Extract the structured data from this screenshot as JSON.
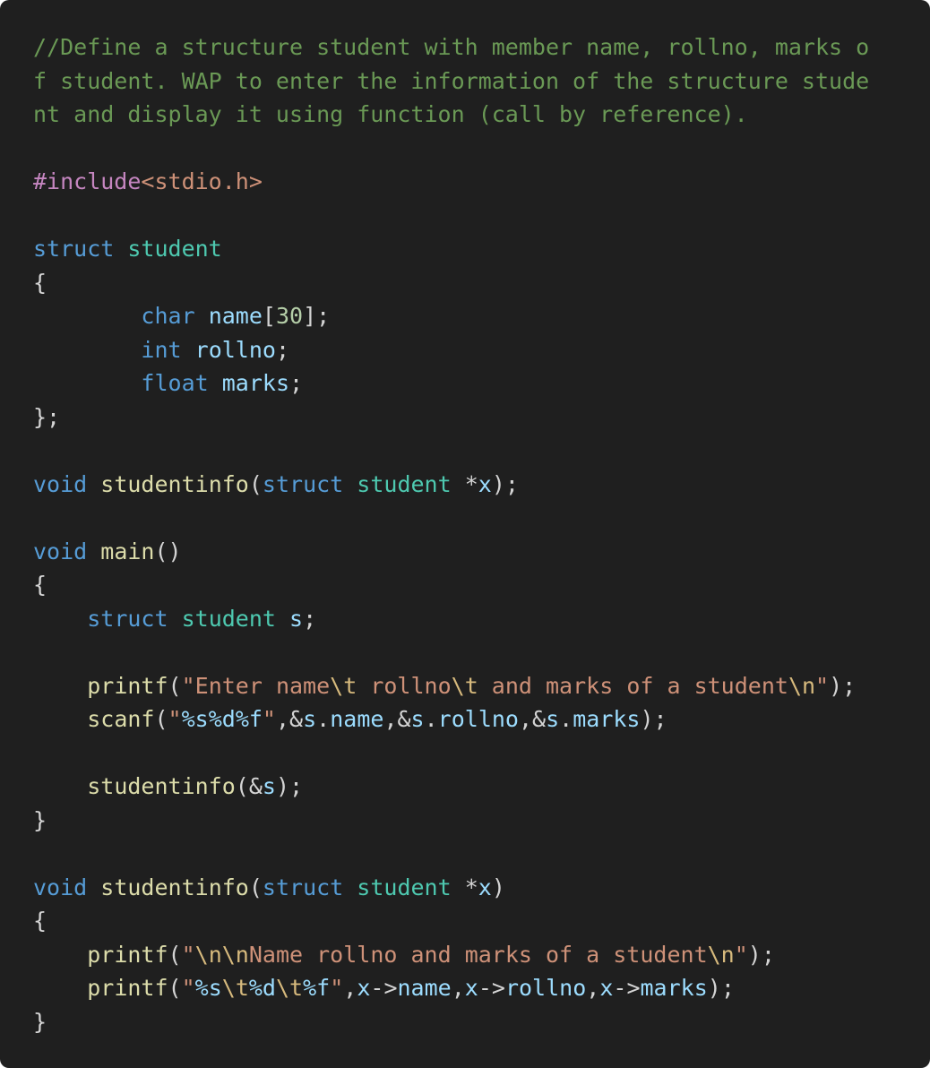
{
  "code": {
    "lines": [
      [
        {
          "t": "//Define a structure student with member name, rollno, marks o",
          "c": "comment"
        }
      ],
      [
        {
          "t": "f student. WAP to enter the information of the structure stude",
          "c": "comment"
        }
      ],
      [
        {
          "t": "nt and display it using function (call by reference).",
          "c": "comment"
        }
      ],
      [],
      [
        {
          "t": "#include",
          "c": "preproc"
        },
        {
          "t": "<stdio.h>",
          "c": "include"
        }
      ],
      [],
      [
        {
          "t": "struct",
          "c": "keyword"
        },
        {
          "t": " ",
          "c": "plain"
        },
        {
          "t": "student",
          "c": "type"
        }
      ],
      [
        {
          "t": "{",
          "c": "plain"
        }
      ],
      [
        {
          "t": "        ",
          "c": "plain"
        },
        {
          "t": "char",
          "c": "keyword"
        },
        {
          "t": " ",
          "c": "plain"
        },
        {
          "t": "name",
          "c": "var"
        },
        {
          "t": "[",
          "c": "plain"
        },
        {
          "t": "30",
          "c": "num"
        },
        {
          "t": "];",
          "c": "plain"
        }
      ],
      [
        {
          "t": "        ",
          "c": "plain"
        },
        {
          "t": "int",
          "c": "keyword"
        },
        {
          "t": " ",
          "c": "plain"
        },
        {
          "t": "rollno",
          "c": "var"
        },
        {
          "t": ";",
          "c": "plain"
        }
      ],
      [
        {
          "t": "        ",
          "c": "plain"
        },
        {
          "t": "float",
          "c": "keyword"
        },
        {
          "t": " ",
          "c": "plain"
        },
        {
          "t": "marks",
          "c": "var"
        },
        {
          "t": ";",
          "c": "plain"
        }
      ],
      [
        {
          "t": "};",
          "c": "plain"
        }
      ],
      [],
      [
        {
          "t": "void",
          "c": "keyword"
        },
        {
          "t": " ",
          "c": "plain"
        },
        {
          "t": "studentinfo",
          "c": "func"
        },
        {
          "t": "(",
          "c": "plain"
        },
        {
          "t": "struct",
          "c": "keyword"
        },
        {
          "t": " ",
          "c": "plain"
        },
        {
          "t": "student",
          "c": "type"
        },
        {
          "t": " *",
          "c": "plain"
        },
        {
          "t": "x",
          "c": "var"
        },
        {
          "t": ");",
          "c": "plain"
        }
      ],
      [],
      [
        {
          "t": "void",
          "c": "keyword"
        },
        {
          "t": " ",
          "c": "plain"
        },
        {
          "t": "main",
          "c": "func"
        },
        {
          "t": "()",
          "c": "plain"
        }
      ],
      [
        {
          "t": "{",
          "c": "plain"
        }
      ],
      [
        {
          "t": "    ",
          "c": "plain"
        },
        {
          "t": "struct",
          "c": "keyword"
        },
        {
          "t": " ",
          "c": "plain"
        },
        {
          "t": "student",
          "c": "type"
        },
        {
          "t": " ",
          "c": "plain"
        },
        {
          "t": "s",
          "c": "var"
        },
        {
          "t": ";",
          "c": "plain"
        }
      ],
      [],
      [
        {
          "t": "    ",
          "c": "plain"
        },
        {
          "t": "printf",
          "c": "func"
        },
        {
          "t": "(",
          "c": "plain"
        },
        {
          "t": "\"Enter name",
          "c": "string"
        },
        {
          "t": "\\t",
          "c": "escape"
        },
        {
          "t": " rollno",
          "c": "string"
        },
        {
          "t": "\\t",
          "c": "escape"
        },
        {
          "t": " and marks of a student",
          "c": "string"
        },
        {
          "t": "\\n",
          "c": "escape"
        },
        {
          "t": "\"",
          "c": "string"
        },
        {
          "t": ");",
          "c": "plain"
        }
      ],
      [
        {
          "t": "    ",
          "c": "plain"
        },
        {
          "t": "scanf",
          "c": "func"
        },
        {
          "t": "(",
          "c": "plain"
        },
        {
          "t": "\"",
          "c": "string"
        },
        {
          "t": "%s%d%f",
          "c": "var"
        },
        {
          "t": "\"",
          "c": "string"
        },
        {
          "t": ",&",
          "c": "plain"
        },
        {
          "t": "s",
          "c": "var"
        },
        {
          "t": ".",
          "c": "plain"
        },
        {
          "t": "name",
          "c": "var"
        },
        {
          "t": ",&",
          "c": "plain"
        },
        {
          "t": "s",
          "c": "var"
        },
        {
          "t": ".",
          "c": "plain"
        },
        {
          "t": "rollno",
          "c": "var"
        },
        {
          "t": ",&",
          "c": "plain"
        },
        {
          "t": "s",
          "c": "var"
        },
        {
          "t": ".",
          "c": "plain"
        },
        {
          "t": "marks",
          "c": "var"
        },
        {
          "t": ");",
          "c": "plain"
        }
      ],
      [],
      [
        {
          "t": "    ",
          "c": "plain"
        },
        {
          "t": "studentinfo",
          "c": "func"
        },
        {
          "t": "(&",
          "c": "plain"
        },
        {
          "t": "s",
          "c": "var"
        },
        {
          "t": ");",
          "c": "plain"
        }
      ],
      [
        {
          "t": "}",
          "c": "plain"
        }
      ],
      [],
      [
        {
          "t": "void",
          "c": "keyword"
        },
        {
          "t": " ",
          "c": "plain"
        },
        {
          "t": "studentinfo",
          "c": "func"
        },
        {
          "t": "(",
          "c": "plain"
        },
        {
          "t": "struct",
          "c": "keyword"
        },
        {
          "t": " ",
          "c": "plain"
        },
        {
          "t": "student",
          "c": "type"
        },
        {
          "t": " *",
          "c": "plain"
        },
        {
          "t": "x",
          "c": "var"
        },
        {
          "t": ")",
          "c": "plain"
        }
      ],
      [
        {
          "t": "{",
          "c": "plain"
        }
      ],
      [
        {
          "t": "    ",
          "c": "plain"
        },
        {
          "t": "printf",
          "c": "func"
        },
        {
          "t": "(",
          "c": "plain"
        },
        {
          "t": "\"",
          "c": "string"
        },
        {
          "t": "\\n\\n",
          "c": "escape"
        },
        {
          "t": "Name rollno and marks of a student",
          "c": "string"
        },
        {
          "t": "\\n",
          "c": "escape"
        },
        {
          "t": "\"",
          "c": "string"
        },
        {
          "t": ");",
          "c": "plain"
        }
      ],
      [
        {
          "t": "    ",
          "c": "plain"
        },
        {
          "t": "printf",
          "c": "func"
        },
        {
          "t": "(",
          "c": "plain"
        },
        {
          "t": "\"",
          "c": "string"
        },
        {
          "t": "%s",
          "c": "var"
        },
        {
          "t": "\\t",
          "c": "escape"
        },
        {
          "t": "%d",
          "c": "var"
        },
        {
          "t": "\\t",
          "c": "escape"
        },
        {
          "t": "%f",
          "c": "var"
        },
        {
          "t": "\"",
          "c": "string"
        },
        {
          "t": ",",
          "c": "plain"
        },
        {
          "t": "x",
          "c": "var"
        },
        {
          "t": "->",
          "c": "plain"
        },
        {
          "t": "name",
          "c": "var"
        },
        {
          "t": ",",
          "c": "plain"
        },
        {
          "t": "x",
          "c": "var"
        },
        {
          "t": "->",
          "c": "plain"
        },
        {
          "t": "rollno",
          "c": "var"
        },
        {
          "t": ",",
          "c": "plain"
        },
        {
          "t": "x",
          "c": "var"
        },
        {
          "t": "->",
          "c": "plain"
        },
        {
          "t": "marks",
          "c": "var"
        },
        {
          "t": ");",
          "c": "plain"
        }
      ],
      [
        {
          "t": "}",
          "c": "plain"
        }
      ]
    ]
  },
  "colors": {
    "background": "#1f1f1f",
    "comment": "#6a9955",
    "keyword": "#569cd6",
    "type": "#4ec9b0",
    "function": "#dcdcaa",
    "variable": "#9cdcfe",
    "string": "#ce9178",
    "number": "#b5cea8",
    "preprocessor": "#c586c0"
  }
}
